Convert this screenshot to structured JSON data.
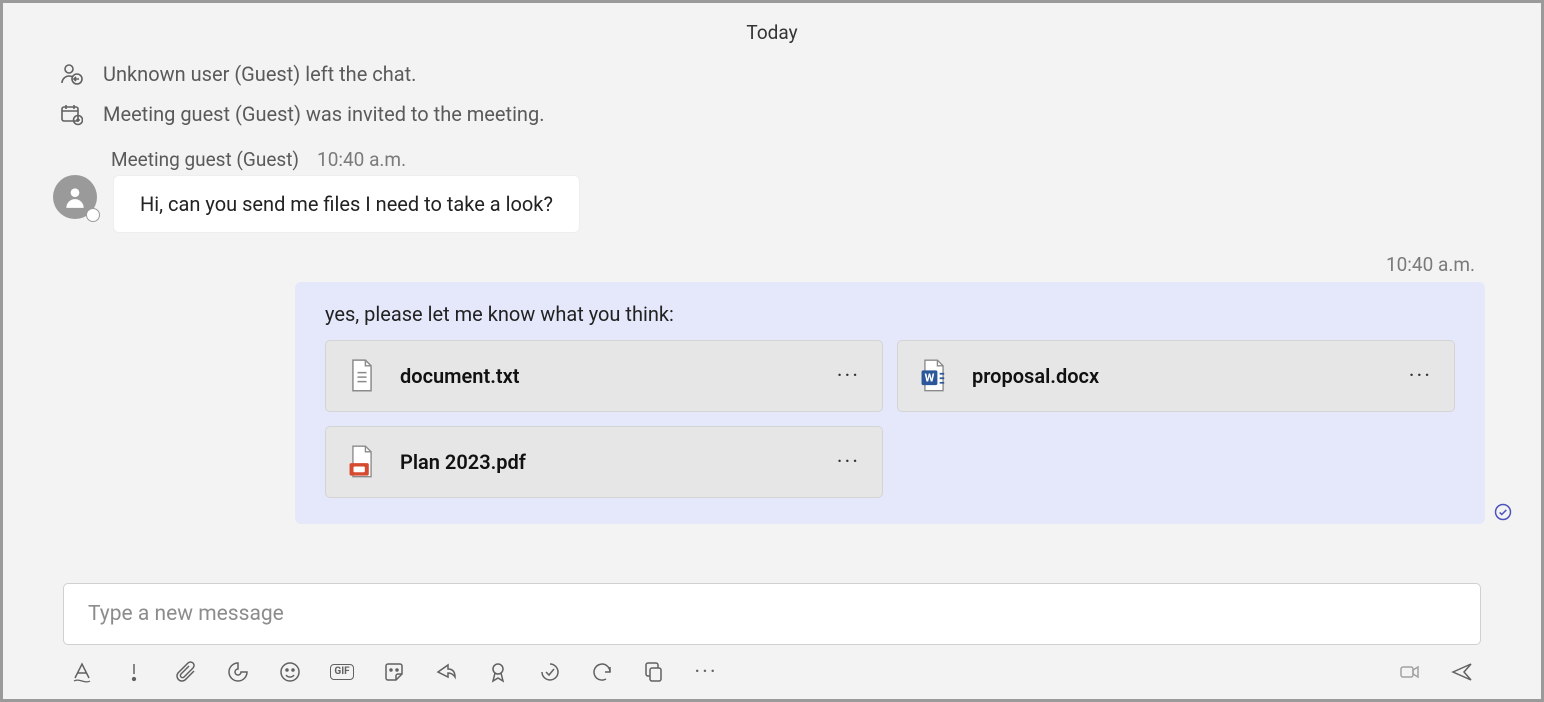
{
  "date_divider": "Today",
  "system_events": [
    {
      "icon": "person-left-icon",
      "text": "Unknown user (Guest) left the chat."
    },
    {
      "icon": "calendar-add-icon",
      "text": "Meeting guest (Guest) was invited to the meeting."
    }
  ],
  "incoming": {
    "sender": "Meeting guest (Guest)",
    "timestamp": "10:40 a.m.",
    "body": "Hi, can you send me files I need to take a look?"
  },
  "outgoing": {
    "timestamp": "10:40 a.m.",
    "body": "yes, please let me know what you think:",
    "files": [
      {
        "name": "document.txt",
        "type": "txt"
      },
      {
        "name": "proposal.docx",
        "type": "docx"
      },
      {
        "name": "Plan 2023.pdf",
        "type": "pdf"
      }
    ]
  },
  "composer": {
    "placeholder": "Type a new message"
  },
  "toolbar_more_glyph": "···",
  "gif_label": "GIF"
}
